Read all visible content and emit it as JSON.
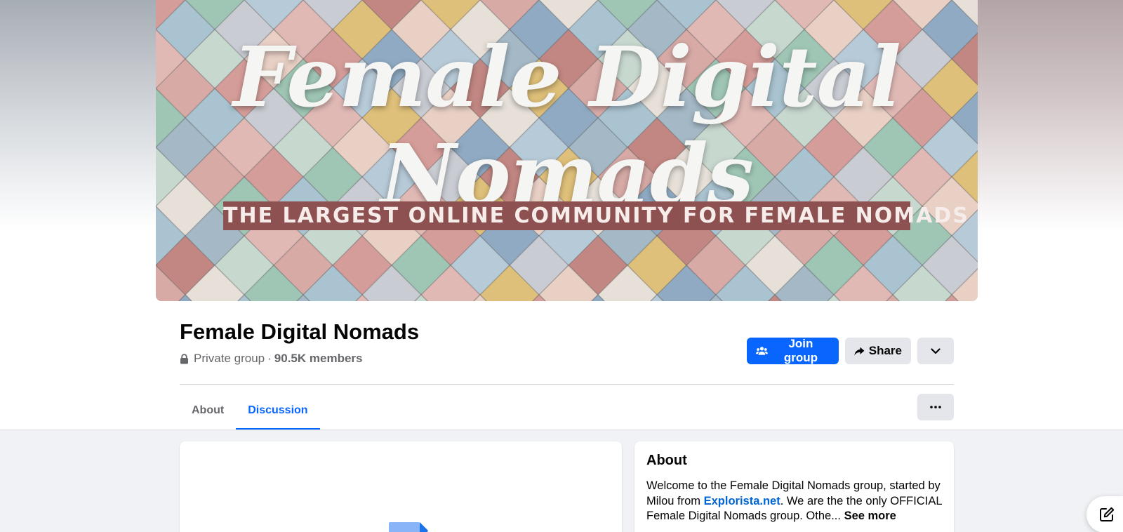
{
  "cover": {
    "title": "Female Digital Nomads",
    "banner": "THE LARGEST ONLINE COMMUNITY FOR FEMALE NOMADS"
  },
  "group": {
    "name": "Female Digital Nomads",
    "privacy": "Private group",
    "separator": "·",
    "members": "90.5K members"
  },
  "actions": {
    "join_label": "Join group",
    "share_label": "Share"
  },
  "tabs": [
    {
      "label": "About",
      "active": false
    },
    {
      "label": "Discussion",
      "active": true
    }
  ],
  "about": {
    "heading": "About",
    "text_1": "Welcome to the Female Digital Nomads group, started by Milou from ",
    "link": "Explorista.net",
    "text_2": ". We are the the only OFFICIAL Female Digital Nomads group. Othe...",
    "see_more": "See more"
  },
  "colors": {
    "accent": "#0866ff",
    "button_gray": "#e4e6eb",
    "banner": "#8c5150"
  },
  "icons": [
    "lock-icon",
    "people-icon",
    "share-arrow-icon",
    "chevron-down-icon",
    "more-dots-icon",
    "compose-icon"
  ]
}
